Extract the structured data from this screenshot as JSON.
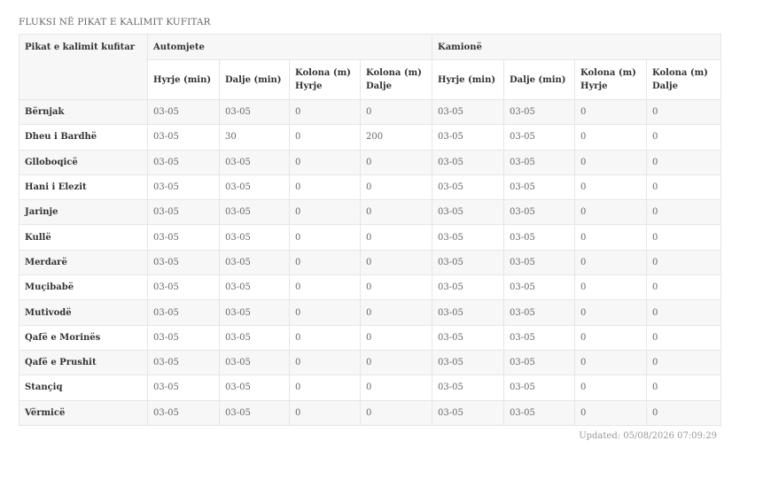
{
  "title": "FLUKSI NË PIKAT E KALIMIT KUFITAR",
  "headers": {
    "corner": "Pikat e kalimit kufitar",
    "group_cars": "Automjete",
    "group_trucks": "Kamionë",
    "sub": [
      "Hyrje (min)",
      "Dalje (min)",
      "Kolona (m) Hyrje",
      "Kolona (m) Dalje",
      "Hyrje (min)",
      "Dalje (min)",
      "Kolona (m) Hyrje",
      "Kolona (m) Dalje"
    ]
  },
  "rows": [
    {
      "name": "Bërnjak",
      "values": [
        "03-05",
        "03-05",
        "0",
        "0",
        "03-05",
        "03-05",
        "0",
        "0"
      ]
    },
    {
      "name": "Dheu i Bardhë",
      "values": [
        "03-05",
        "30",
        "0",
        "200",
        "03-05",
        "03-05",
        "0",
        "0"
      ]
    },
    {
      "name": "Glloboqicë",
      "values": [
        "03-05",
        "03-05",
        "0",
        "0",
        "03-05",
        "03-05",
        "0",
        "0"
      ]
    },
    {
      "name": "Hani i Elezit",
      "values": [
        "03-05",
        "03-05",
        "0",
        "0",
        "03-05",
        "03-05",
        "0",
        "0"
      ]
    },
    {
      "name": "Jarinje",
      "values": [
        "03-05",
        "03-05",
        "0",
        "0",
        "03-05",
        "03-05",
        "0",
        "0"
      ]
    },
    {
      "name": "Kullë",
      "values": [
        "03-05",
        "03-05",
        "0",
        "0",
        "03-05",
        "03-05",
        "0",
        "0"
      ]
    },
    {
      "name": "Merdarë",
      "values": [
        "03-05",
        "03-05",
        "0",
        "0",
        "03-05",
        "03-05",
        "0",
        "0"
      ]
    },
    {
      "name": "Muçibabë",
      "values": [
        "03-05",
        "03-05",
        "0",
        "0",
        "03-05",
        "03-05",
        "0",
        "0"
      ]
    },
    {
      "name": "Mutivodë",
      "values": [
        "03-05",
        "03-05",
        "0",
        "0",
        "03-05",
        "03-05",
        "0",
        "0"
      ]
    },
    {
      "name": "Qafë e Morinës",
      "values": [
        "03-05",
        "03-05",
        "0",
        "0",
        "03-05",
        "03-05",
        "0",
        "0"
      ]
    },
    {
      "name": "Qafë e Prushit",
      "values": [
        "03-05",
        "03-05",
        "0",
        "0",
        "03-05",
        "03-05",
        "0",
        "0"
      ]
    },
    {
      "name": "Stançiq",
      "values": [
        "03-05",
        "03-05",
        "0",
        "0",
        "03-05",
        "03-05",
        "0",
        "0"
      ]
    },
    {
      "name": "Vërmicë",
      "values": [
        "03-05",
        "03-05",
        "0",
        "0",
        "03-05",
        "03-05",
        "0",
        "0"
      ]
    }
  ],
  "updated": "Updated: 05/08/2026 07:09:29"
}
